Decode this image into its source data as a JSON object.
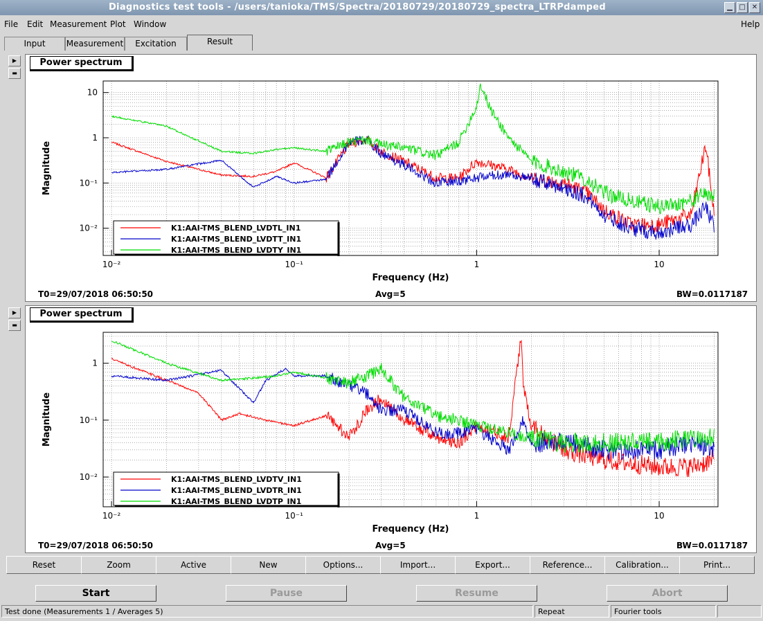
{
  "window": {
    "title": "Diagnostics test tools - /users/tanioka/TMS/Spectra/20180729/20180729_spectra_LTRPdamped",
    "buttons": [
      "▁",
      "□",
      "✕"
    ]
  },
  "menu": {
    "items": [
      "File",
      "Edit",
      "Measurement",
      "Plot",
      "Window"
    ],
    "help": "Help"
  },
  "tabs": [
    {
      "label": "Input",
      "active": false
    },
    {
      "label": "Measurement",
      "active": false
    },
    {
      "label": "Excitation",
      "active": false
    },
    {
      "label": "Result",
      "active": true
    }
  ],
  "plots": [
    {
      "title": "Power spectrum",
      "footer": {
        "t0": "T0=29/07/2018 06:50:50",
        "avg": "Avg=5",
        "bw": "BW=0.0117187"
      },
      "chart_data": {
        "type": "line",
        "xlabel": "Frequency (Hz)",
        "ylabel": "Magnitude",
        "xscale": "log",
        "yscale": "log",
        "xlim": [
          0.009,
          21
        ],
        "ylim": [
          0.0025,
          18
        ],
        "xticks": [
          "10⁻²",
          "10⁻¹",
          "1",
          "10"
        ],
        "yticks": [
          "10⁻²",
          "10⁻¹",
          "1",
          "10"
        ],
        "grid": true,
        "legend_position": "bottom-left",
        "series": [
          {
            "name": "K1:AAI-TMS_BLEND_LVDTL_IN1",
            "color": "#ff0000",
            "x": [
              0.01,
              0.02,
              0.04,
              0.06,
              0.08,
              0.1,
              0.15,
              0.2,
              0.25,
              0.3,
              0.4,
              0.6,
              0.8,
              1.0,
              1.5,
              2.0,
              3.0,
              4.0,
              5.0,
              7.0,
              10.0,
              15.0,
              18.0,
              20.0
            ],
            "y": [
              0.8,
              0.3,
              0.15,
              0.14,
              0.18,
              0.28,
              0.13,
              0.75,
              0.9,
              0.5,
              0.3,
              0.13,
              0.13,
              0.3,
              0.2,
              0.13,
              0.1,
              0.06,
              0.025,
              0.012,
              0.012,
              0.02,
              0.7,
              0.02
            ]
          },
          {
            "name": "K1:AAI-TMS_BLEND_LVDTT_IN1",
            "color": "#0000cc",
            "x": [
              0.01,
              0.02,
              0.04,
              0.06,
              0.08,
              0.1,
              0.15,
              0.2,
              0.25,
              0.3,
              0.4,
              0.6,
              0.8,
              1.0,
              1.5,
              2.0,
              3.0,
              4.0,
              5.0,
              7.0,
              10.0,
              15.0,
              18.0,
              20.0
            ],
            "y": [
              0.17,
              0.2,
              0.32,
              0.08,
              0.14,
              0.1,
              0.12,
              0.8,
              0.9,
              0.45,
              0.25,
              0.1,
              0.11,
              0.13,
              0.16,
              0.12,
              0.08,
              0.05,
              0.02,
              0.01,
              0.008,
              0.012,
              0.03,
              0.01
            ]
          },
          {
            "name": "K1:AAI-TMS_BLEND_LVDTY_IN1",
            "color": "#00dd00",
            "x": [
              0.01,
              0.02,
              0.04,
              0.06,
              0.08,
              0.1,
              0.15,
              0.2,
              0.25,
              0.3,
              0.4,
              0.6,
              0.8,
              1.0,
              1.05,
              1.2,
              1.5,
              2.0,
              3.0,
              4.0,
              5.0,
              7.0,
              10.0,
              15.0,
              18.0,
              20.0
            ],
            "y": [
              3.0,
              1.8,
              0.5,
              0.45,
              0.55,
              0.6,
              0.5,
              0.8,
              0.9,
              0.7,
              0.6,
              0.4,
              0.8,
              5.0,
              15.0,
              4.0,
              1.0,
              0.3,
              0.18,
              0.12,
              0.06,
              0.04,
              0.03,
              0.04,
              0.06,
              0.05
            ]
          }
        ]
      }
    },
    {
      "title": "Power spectrum",
      "footer": {
        "t0": "T0=29/07/2018 06:50:50",
        "avg": "Avg=5",
        "bw": "BW=0.0117187"
      },
      "chart_data": {
        "type": "line",
        "xlabel": "Frequency (Hz)",
        "ylabel": "Magnitude",
        "xscale": "log",
        "yscale": "log",
        "xlim": [
          0.009,
          21
        ],
        "ylim": [
          0.003,
          3.5
        ],
        "xticks": [
          "10⁻²",
          "10⁻¹",
          "1",
          "10"
        ],
        "yticks": [
          "10⁻²",
          "10⁻¹",
          "1"
        ],
        "grid": true,
        "legend_position": "bottom-left",
        "series": [
          {
            "name": "K1:AAI-TMS_BLEND_LVDTV_IN1",
            "color": "#ff0000",
            "x": [
              0.01,
              0.02,
              0.03,
              0.04,
              0.05,
              0.07,
              0.1,
              0.15,
              0.2,
              0.25,
              0.3,
              0.4,
              0.6,
              0.8,
              1.0,
              1.5,
              1.75,
              1.8,
              2.0,
              3.0,
              5.0,
              10.0,
              15.0,
              20.0
            ],
            "y": [
              1.2,
              0.5,
              0.3,
              0.1,
              0.13,
              0.1,
              0.08,
              0.12,
              0.05,
              0.15,
              0.25,
              0.1,
              0.05,
              0.04,
              0.08,
              0.05,
              3.0,
              0.4,
              0.08,
              0.03,
              0.02,
              0.015,
              0.015,
              0.02
            ]
          },
          {
            "name": "K1:AAI-TMS_BLEND_LVDTR_IN1",
            "color": "#0000cc",
            "x": [
              0.01,
              0.02,
              0.04,
              0.06,
              0.07,
              0.09,
              0.1,
              0.15,
              0.2,
              0.25,
              0.3,
              0.4,
              0.6,
              0.8,
              1.0,
              1.5,
              1.8,
              2.0,
              3.0,
              5.0,
              10.0,
              15.0,
              20.0
            ],
            "y": [
              0.6,
              0.5,
              0.75,
              0.2,
              0.5,
              0.8,
              0.6,
              0.6,
              0.4,
              0.3,
              0.15,
              0.15,
              0.06,
              0.06,
              0.07,
              0.03,
              0.1,
              0.04,
              0.04,
              0.03,
              0.03,
              0.04,
              0.03
            ]
          },
          {
            "name": "K1:AAI-TMS_BLEND_LVDTP_IN1",
            "color": "#00dd00",
            "x": [
              0.01,
              0.02,
              0.04,
              0.06,
              0.08,
              0.1,
              0.15,
              0.2,
              0.25,
              0.3,
              0.4,
              0.6,
              0.8,
              1.0,
              1.5,
              2.0,
              3.0,
              5.0,
              10.0,
              15.0,
              20.0
            ],
            "y": [
              2.5,
              1.0,
              0.5,
              0.55,
              0.6,
              0.7,
              0.55,
              0.45,
              0.6,
              0.8,
              0.25,
              0.12,
              0.1,
              0.08,
              0.06,
              0.05,
              0.04,
              0.04,
              0.04,
              0.05,
              0.05
            ]
          }
        ]
      }
    }
  ],
  "toolbar": [
    "Reset",
    "Zoom",
    "Active",
    "New",
    "Options...",
    "Import...",
    "Export...",
    "Reference...",
    "Calibration...",
    "Print..."
  ],
  "controls": {
    "start": "Start",
    "pause": "Pause",
    "resume": "Resume",
    "abort": "Abort"
  },
  "status": {
    "message": "Test done (Measurements 1 / Averages 5)",
    "mode": "Repeat",
    "tool": "Fourier tools"
  }
}
